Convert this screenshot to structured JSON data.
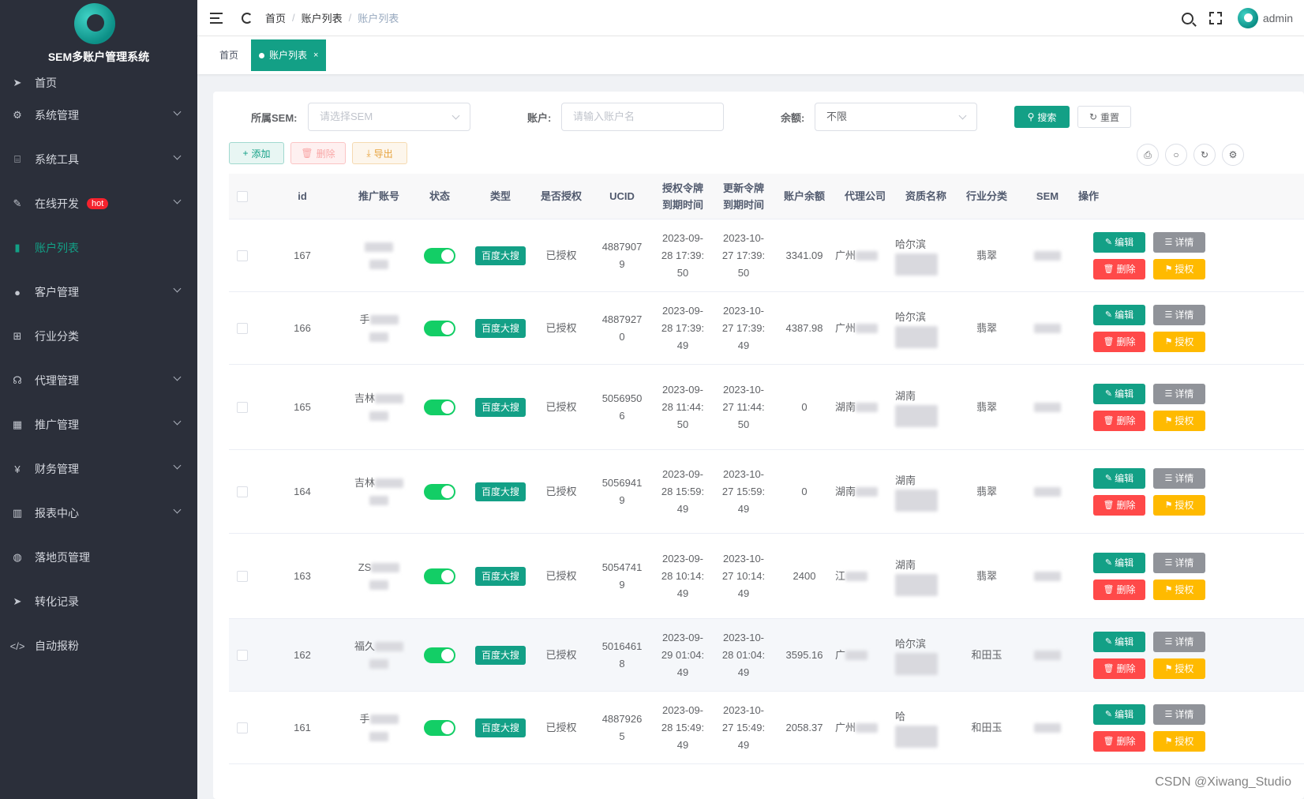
{
  "app": {
    "title": "SEM多账户管理系统"
  },
  "sidebar": {
    "items": [
      {
        "label": "首页",
        "icon": "send-icon",
        "glyph": "➤",
        "expandable": false,
        "active": false
      },
      {
        "label": "系统管理",
        "icon": "gear-icon",
        "glyph": "⚙",
        "expandable": true,
        "active": false
      },
      {
        "label": "系统工具",
        "icon": "toolbox-icon",
        "glyph": "⌸",
        "expandable": true,
        "active": false
      },
      {
        "label": "在线开发",
        "icon": "edit-icon",
        "glyph": "✎",
        "expandable": true,
        "active": false,
        "badge": "hot"
      },
      {
        "label": "账户列表",
        "icon": "book-icon",
        "glyph": "▮",
        "expandable": false,
        "active": true
      },
      {
        "label": "客户管理",
        "icon": "user-icon",
        "glyph": "●",
        "expandable": true,
        "active": false
      },
      {
        "label": "行业分类",
        "icon": "sitemap-icon",
        "glyph": "⊞",
        "expandable": false,
        "active": false
      },
      {
        "label": "代理管理",
        "icon": "agent-icon",
        "glyph": "☊",
        "expandable": true,
        "active": false
      },
      {
        "label": "推广管理",
        "icon": "grid-icon",
        "glyph": "▦",
        "expandable": true,
        "active": false
      },
      {
        "label": "财务管理",
        "icon": "yen-icon",
        "glyph": "¥",
        "expandable": true,
        "active": false
      },
      {
        "label": "报表中心",
        "icon": "bar-chart-icon",
        "glyph": "▥",
        "expandable": true,
        "active": false
      },
      {
        "label": "落地页管理",
        "icon": "globe-icon",
        "glyph": "◍",
        "expandable": false,
        "active": false
      },
      {
        "label": "转化记录",
        "icon": "send-icon",
        "glyph": "➤",
        "expandable": false,
        "active": false
      },
      {
        "label": "自动报粉",
        "icon": "code-icon",
        "glyph": "</>",
        "expandable": false,
        "active": false
      }
    ]
  },
  "header": {
    "breadcrumb": [
      "首页",
      "账户列表",
      "账户列表"
    ],
    "user": "admin"
  },
  "tags": {
    "home": "首页",
    "active": "账户列表",
    "close": "×"
  },
  "search_form": {
    "sem_label": "所属SEM:",
    "sem_placeholder": "请选择SEM",
    "account_label": "账户:",
    "account_placeholder": "请输入账户名",
    "balance_label": "余额:",
    "balance_value": "不限",
    "search_btn": "搜索",
    "reset_btn": "重置"
  },
  "toolbar": {
    "add": "添加",
    "delete": "删除",
    "export": "导出"
  },
  "table": {
    "columns": [
      "id",
      "推广账号",
      "状态",
      "类型",
      "是否授权",
      "UCID",
      "授权令牌\n到期时间",
      "更新令牌\n到期时间",
      "账户余额",
      "代理公司",
      "资质名称",
      "行业分类",
      "SEM",
      "操作"
    ],
    "actions": {
      "edit": "编辑",
      "detail": "详情",
      "delete": "删除",
      "auth": "授权"
    },
    "rows": [
      {
        "id": "167",
        "account": "",
        "type": "百度大搜",
        "auth": "已授权",
        "ucid": [
          "4887907",
          "9"
        ],
        "t1": [
          "2023-09-",
          "28 17:39:",
          "50"
        ],
        "t2": [
          "2023-10-",
          "27 17:39:",
          "50"
        ],
        "balance": "3341.09",
        "agent": "广州",
        "qual": "哈尔滨",
        "industry": "翡翠"
      },
      {
        "id": "166",
        "account": "手",
        "type": "百度大搜",
        "auth": "已授权",
        "ucid": [
          "4887927",
          "0"
        ],
        "t1": [
          "2023-09-",
          "28 17:39:",
          "49"
        ],
        "t2": [
          "2023-10-",
          "27 17:39:",
          "49"
        ],
        "balance": "4387.98",
        "agent": "广州",
        "qual": "哈尔滨",
        "industry": "翡翠"
      },
      {
        "id": "165",
        "account": "吉林",
        "type": "百度大搜",
        "auth": "已授权",
        "ucid": [
          "5056950",
          "6"
        ],
        "t1": [
          "2023-09-",
          "28 11:44:",
          "50"
        ],
        "t2": [
          "2023-10-",
          "27 11:44:",
          "50"
        ],
        "balance": "0",
        "agent": "湖南",
        "qual": "湖南",
        "industry": "翡翠"
      },
      {
        "id": "164",
        "account": "吉林",
        "type": "百度大搜",
        "auth": "已授权",
        "ucid": [
          "5056941",
          "9"
        ],
        "t1": [
          "2023-09-",
          "28 15:59:",
          "49"
        ],
        "t2": [
          "2023-10-",
          "27 15:59:",
          "49"
        ],
        "balance": "0",
        "agent": "湖南",
        "qual": "湖南",
        "industry": "翡翠"
      },
      {
        "id": "163",
        "account": "ZS",
        "type": "百度大搜",
        "auth": "已授权",
        "ucid": [
          "5054741",
          "9"
        ],
        "t1": [
          "2023-09-",
          "28 10:14:",
          "49"
        ],
        "t2": [
          "2023-10-",
          "27 10:14:",
          "49"
        ],
        "balance": "2400",
        "agent": "江",
        "qual": "湖南",
        "industry": "翡翠"
      },
      {
        "id": "162",
        "account": "福久",
        "type": "百度大搜",
        "auth": "已授权",
        "ucid": [
          "5016461",
          "8"
        ],
        "t1": [
          "2023-09-",
          "29 01:04:",
          "49"
        ],
        "t2": [
          "2023-10-",
          "28 01:04:",
          "49"
        ],
        "balance": "3595.16",
        "agent": "广",
        "qual": "哈尔滨",
        "industry": "和田玉"
      },
      {
        "id": "161",
        "account": "手",
        "type": "百度大搜",
        "auth": "已授权",
        "ucid": [
          "4887926",
          "5"
        ],
        "t1": [
          "2023-09-",
          "28 15:49:",
          "49"
        ],
        "t2": [
          "2023-10-",
          "27 15:49:",
          "49"
        ],
        "balance": "2058.37",
        "agent": "广州",
        "qual": "哈",
        "industry": "和田玉"
      }
    ]
  },
  "watermark": "CSDN @Xiwang_Studio",
  "colors": {
    "sidebar_bg": "#2b2f3a",
    "primary": "#13a086",
    "danger": "#ff4949",
    "warning": "#ffba00",
    "info": "#909399",
    "switch_on": "#13ce66"
  }
}
